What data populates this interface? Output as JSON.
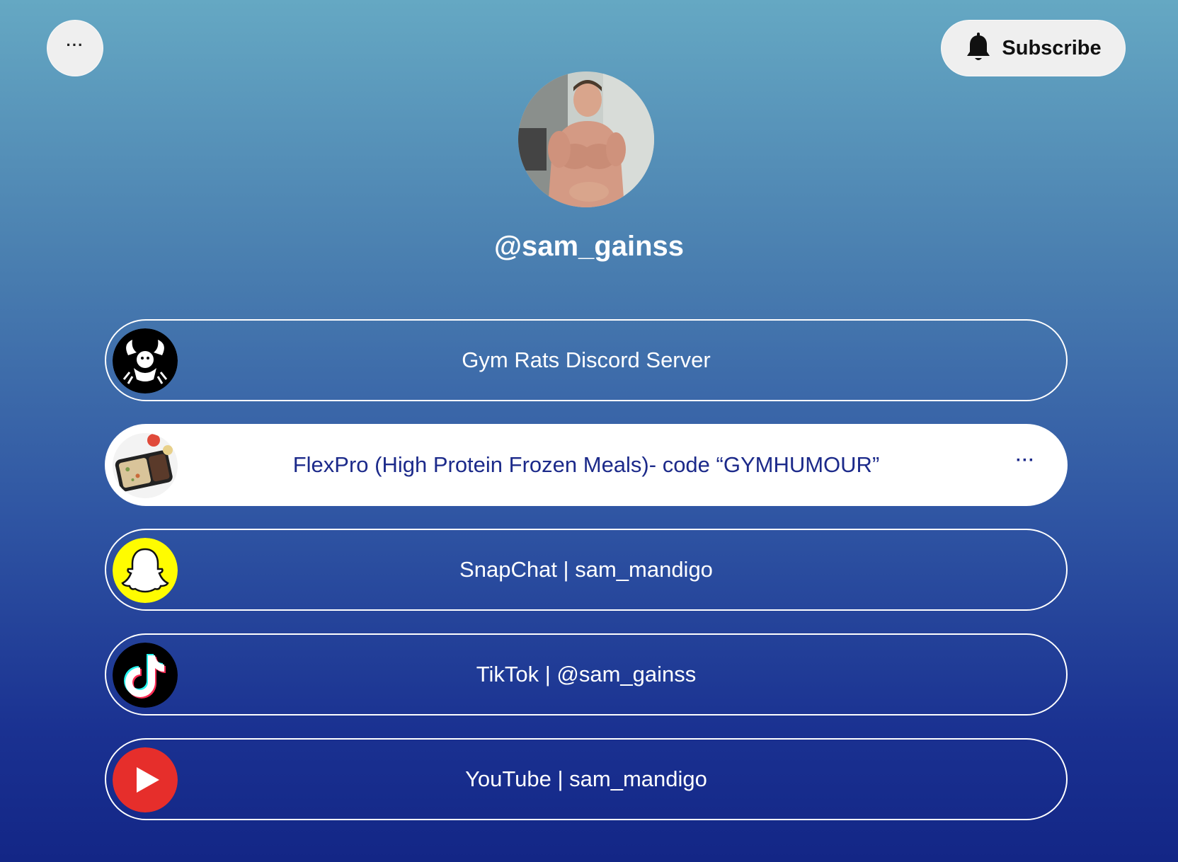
{
  "header": {
    "menu_label": "···",
    "subscribe_label": "Subscribe"
  },
  "profile": {
    "username": "@sam_gainss"
  },
  "links": [
    {
      "label": "Gym Rats Discord Server",
      "icon": "discord-logo-icon"
    },
    {
      "label": "FlexPro (High Protein Frozen Meals)- code “GYMHUMOUR”",
      "icon": "meal-tray-image",
      "more": "···"
    },
    {
      "label": "SnapChat | sam_mandigo",
      "icon": "snapchat-ghost-icon"
    },
    {
      "label": "TikTok | @sam_gainss",
      "icon": "tiktok-icon"
    },
    {
      "label": "YouTube | sam_mandigo",
      "icon": "youtube-play-icon"
    }
  ],
  "colors": {
    "gradient_top": "#65a8c3",
    "gradient_bottom": "#132686",
    "button_bg": "#efefef",
    "highlight_text": "#1c2a8a",
    "snapchat_yellow": "#fffc00",
    "youtube_red": "#e62e2b"
  }
}
